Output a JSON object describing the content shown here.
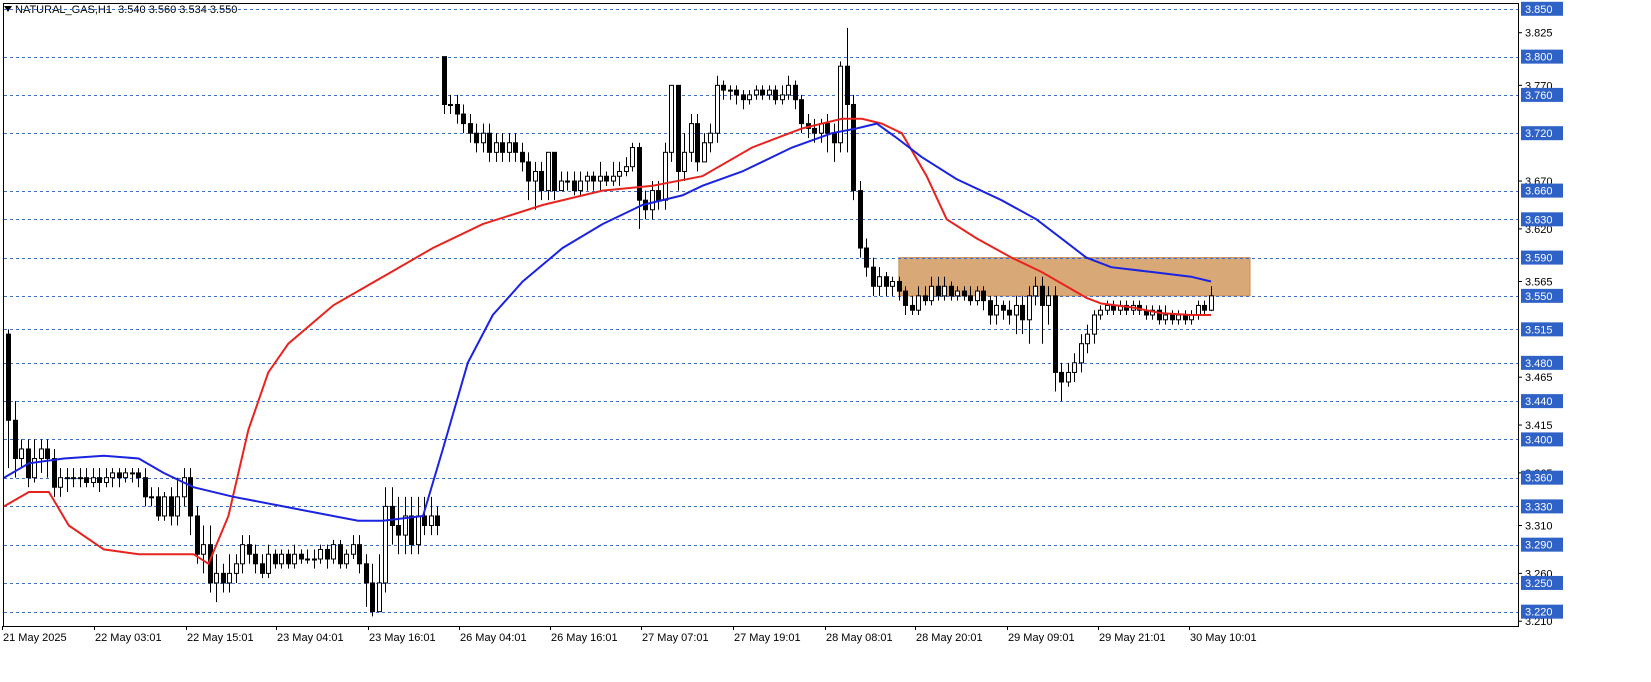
{
  "header": {
    "symbol": "NATURAL_GAS,H1",
    "ohlc": "3.540 3.560 3.534 3.550"
  },
  "colors": {
    "grid": "#3a6fc4",
    "label_bg": "#2f62c6",
    "ma_fast": "#e8231e",
    "ma_slow": "#1a23e0",
    "zone": "#d9a877",
    "candle": "#000000"
  },
  "chart_data": {
    "type": "candlestick",
    "ylim": [
      3.205,
      3.855
    ],
    "y_ticks": [
      3.825,
      3.77,
      3.67,
      3.62,
      3.565,
      3.465,
      3.415,
      3.365,
      3.31,
      3.26,
      3.21
    ],
    "y_levels": [
      3.85,
      3.8,
      3.76,
      3.72,
      3.66,
      3.63,
      3.59,
      3.55,
      3.515,
      3.48,
      3.44,
      3.4,
      3.36,
      3.33,
      3.29,
      3.25,
      3.22
    ],
    "x_labels": [
      "21 May 2025",
      "22 May 03:01",
      "22 May 15:01",
      "23 May 04:01",
      "23 May 16:01",
      "26 May 04:01",
      "26 May 16:01",
      "27 May 07:01",
      "27 May 19:01",
      "28 May 08:01",
      "28 May 20:01",
      "29 May 09:01",
      "29 May 21:01",
      "30 May 10:01"
    ],
    "zone": {
      "bar_start": 137,
      "bar_end": 191,
      "low": 3.55,
      "high": 3.59
    },
    "candles": [
      [
        3.51,
        3.42,
        3.37,
        3.515
      ],
      [
        3.42,
        3.38,
        3.36,
        3.44
      ],
      [
        3.38,
        3.39,
        3.37,
        3.4
      ],
      [
        3.39,
        3.36,
        3.35,
        3.4
      ],
      [
        3.36,
        3.38,
        3.355,
        3.4
      ],
      [
        3.38,
        3.39,
        3.365,
        3.4
      ],
      [
        3.39,
        3.38,
        3.36,
        3.4
      ],
      [
        3.38,
        3.35,
        3.34,
        3.39
      ],
      [
        3.35,
        3.36,
        3.34,
        3.37
      ],
      [
        3.36,
        3.36,
        3.345,
        3.37
      ],
      [
        3.36,
        3.36,
        3.35,
        3.37
      ],
      [
        3.36,
        3.36,
        3.35,
        3.37
      ],
      [
        3.36,
        3.355,
        3.35,
        3.37
      ],
      [
        3.355,
        3.36,
        3.35,
        3.37
      ],
      [
        3.36,
        3.355,
        3.345,
        3.37
      ],
      [
        3.355,
        3.36,
        3.35,
        3.37
      ],
      [
        3.36,
        3.365,
        3.35,
        3.37
      ],
      [
        3.365,
        3.36,
        3.35,
        3.37
      ],
      [
        3.36,
        3.365,
        3.355,
        3.37
      ],
      [
        3.365,
        3.365,
        3.355,
        3.37
      ],
      [
        3.365,
        3.36,
        3.35,
        3.37
      ],
      [
        3.36,
        3.34,
        3.33,
        3.37
      ],
      [
        3.34,
        3.34,
        3.33,
        3.35
      ],
      [
        3.34,
        3.32,
        3.315,
        3.35
      ],
      [
        3.32,
        3.34,
        3.315,
        3.345
      ],
      [
        3.34,
        3.32,
        3.31,
        3.35
      ],
      [
        3.32,
        3.34,
        3.31,
        3.36
      ],
      [
        3.34,
        3.36,
        3.33,
        3.37
      ],
      [
        3.36,
        3.32,
        3.3,
        3.37
      ],
      [
        3.32,
        3.28,
        3.27,
        3.33
      ],
      [
        3.28,
        3.29,
        3.26,
        3.31
      ],
      [
        3.29,
        3.25,
        3.24,
        3.31
      ],
      [
        3.25,
        3.26,
        3.23,
        3.28
      ],
      [
        3.26,
        3.25,
        3.24,
        3.27
      ],
      [
        3.25,
        3.26,
        3.24,
        3.28
      ],
      [
        3.26,
        3.27,
        3.25,
        3.28
      ],
      [
        3.27,
        3.29,
        3.26,
        3.3
      ],
      [
        3.29,
        3.28,
        3.27,
        3.3
      ],
      [
        3.28,
        3.27,
        3.26,
        3.29
      ],
      [
        3.27,
        3.26,
        3.255,
        3.28
      ],
      [
        3.26,
        3.28,
        3.255,
        3.29
      ],
      [
        3.28,
        3.27,
        3.265,
        3.285
      ],
      [
        3.27,
        3.28,
        3.265,
        3.285
      ],
      [
        3.28,
        3.27,
        3.265,
        3.285
      ],
      [
        3.27,
        3.28,
        3.265,
        3.29
      ],
      [
        3.28,
        3.275,
        3.27,
        3.285
      ],
      [
        3.275,
        3.275,
        3.27,
        3.285
      ],
      [
        3.275,
        3.275,
        3.265,
        3.285
      ],
      [
        3.275,
        3.285,
        3.27,
        3.29
      ],
      [
        3.285,
        3.275,
        3.265,
        3.29
      ],
      [
        3.275,
        3.29,
        3.27,
        3.295
      ],
      [
        3.29,
        3.27,
        3.265,
        3.295
      ],
      [
        3.27,
        3.28,
        3.265,
        3.285
      ],
      [
        3.28,
        3.29,
        3.275,
        3.3
      ],
      [
        3.29,
        3.27,
        3.26,
        3.3
      ],
      [
        3.27,
        3.25,
        3.225,
        3.28
      ],
      [
        3.25,
        3.22,
        3.215,
        3.27
      ],
      [
        3.22,
        3.25,
        3.22,
        3.28
      ],
      [
        3.25,
        3.33,
        3.24,
        3.35
      ],
      [
        3.33,
        3.31,
        3.29,
        3.35
      ],
      [
        3.31,
        3.3,
        3.28,
        3.34
      ],
      [
        3.3,
        3.32,
        3.28,
        3.34
      ],
      [
        3.32,
        3.29,
        3.28,
        3.34
      ],
      [
        3.29,
        3.32,
        3.28,
        3.34
      ],
      [
        3.32,
        3.31,
        3.3,
        3.34
      ],
      [
        3.31,
        3.32,
        3.3,
        3.34
      ],
      [
        3.32,
        3.31,
        3.3,
        3.33
      ],
      [
        3.8,
        3.75,
        3.74,
        3.8
      ],
      [
        3.75,
        3.75,
        3.74,
        3.76
      ],
      [
        3.75,
        3.74,
        3.73,
        3.76
      ],
      [
        3.74,
        3.73,
        3.72,
        3.75
      ],
      [
        3.73,
        3.72,
        3.71,
        3.74
      ],
      [
        3.72,
        3.71,
        3.7,
        3.73
      ],
      [
        3.71,
        3.72,
        3.7,
        3.73
      ],
      [
        3.72,
        3.7,
        3.69,
        3.73
      ],
      [
        3.7,
        3.71,
        3.69,
        3.72
      ],
      [
        3.71,
        3.7,
        3.69,
        3.72
      ],
      [
        3.7,
        3.71,
        3.69,
        3.72
      ],
      [
        3.71,
        3.7,
        3.69,
        3.72
      ],
      [
        3.7,
        3.69,
        3.68,
        3.71
      ],
      [
        3.69,
        3.67,
        3.65,
        3.7
      ],
      [
        3.67,
        3.68,
        3.64,
        3.69
      ],
      [
        3.68,
        3.66,
        3.65,
        3.69
      ],
      [
        3.66,
        3.7,
        3.65,
        3.7
      ],
      [
        3.7,
        3.66,
        3.65,
        3.7
      ],
      [
        3.66,
        3.67,
        3.66,
        3.68
      ],
      [
        3.67,
        3.67,
        3.66,
        3.68
      ],
      [
        3.67,
        3.66,
        3.655,
        3.68
      ],
      [
        3.66,
        3.67,
        3.655,
        3.68
      ],
      [
        3.67,
        3.675,
        3.66,
        3.68
      ],
      [
        3.675,
        3.67,
        3.66,
        3.68
      ],
      [
        3.67,
        3.675,
        3.66,
        3.69
      ],
      [
        3.675,
        3.67,
        3.665,
        3.68
      ],
      [
        3.67,
        3.675,
        3.665,
        3.69
      ],
      [
        3.675,
        3.68,
        3.665,
        3.69
      ],
      [
        3.68,
        3.685,
        3.675,
        3.695
      ],
      [
        3.685,
        3.705,
        3.68,
        3.71
      ],
      [
        3.705,
        3.65,
        3.62,
        3.71
      ],
      [
        3.65,
        3.64,
        3.63,
        3.66
      ],
      [
        3.64,
        3.66,
        3.63,
        3.67
      ],
      [
        3.66,
        3.65,
        3.64,
        3.67
      ],
      [
        3.65,
        3.7,
        3.64,
        3.71
      ],
      [
        3.7,
        3.77,
        3.69,
        3.77
      ],
      [
        3.77,
        3.68,
        3.66,
        3.77
      ],
      [
        3.68,
        3.7,
        3.67,
        3.72
      ],
      [
        3.7,
        3.73,
        3.69,
        3.74
      ],
      [
        3.73,
        3.69,
        3.68,
        3.74
      ],
      [
        3.69,
        3.71,
        3.69,
        3.72
      ],
      [
        3.71,
        3.72,
        3.7,
        3.73
      ],
      [
        3.72,
        3.77,
        3.71,
        3.78
      ],
      [
        3.77,
        3.765,
        3.755,
        3.775
      ],
      [
        3.765,
        3.765,
        3.755,
        3.77
      ],
      [
        3.765,
        3.76,
        3.75,
        3.77
      ],
      [
        3.76,
        3.755,
        3.745,
        3.765
      ],
      [
        3.755,
        3.76,
        3.75,
        3.765
      ],
      [
        3.76,
        3.765,
        3.755,
        3.77
      ],
      [
        3.765,
        3.76,
        3.755,
        3.77
      ],
      [
        3.76,
        3.765,
        3.755,
        3.77
      ],
      [
        3.765,
        3.755,
        3.75,
        3.77
      ],
      [
        3.755,
        3.76,
        3.75,
        3.77
      ],
      [
        3.76,
        3.77,
        3.755,
        3.78
      ],
      [
        3.77,
        3.755,
        3.745,
        3.775
      ],
      [
        3.755,
        3.73,
        3.72,
        3.76
      ],
      [
        3.73,
        3.725,
        3.715,
        3.74
      ],
      [
        3.725,
        3.72,
        3.71,
        3.735
      ],
      [
        3.72,
        3.73,
        3.71,
        3.735
      ],
      [
        3.73,
        3.72,
        3.7,
        3.74
      ],
      [
        3.72,
        3.71,
        3.69,
        3.73
      ],
      [
        3.71,
        3.79,
        3.7,
        3.795
      ],
      [
        3.79,
        3.75,
        3.7,
        3.83
      ],
      [
        3.75,
        3.66,
        3.65,
        3.76
      ],
      [
        3.66,
        3.6,
        3.59,
        3.67
      ],
      [
        3.6,
        3.58,
        3.57,
        3.61
      ],
      [
        3.58,
        3.56,
        3.55,
        3.59
      ],
      [
        3.56,
        3.57,
        3.55,
        3.58
      ],
      [
        3.57,
        3.56,
        3.55,
        3.575
      ],
      [
        3.56,
        3.565,
        3.55,
        3.57
      ],
      [
        3.565,
        3.555,
        3.545,
        3.57
      ],
      [
        3.555,
        3.54,
        3.53,
        3.56
      ],
      [
        3.54,
        3.535,
        3.53,
        3.55
      ],
      [
        3.535,
        3.55,
        3.53,
        3.56
      ],
      [
        3.55,
        3.545,
        3.54,
        3.56
      ],
      [
        3.545,
        3.56,
        3.54,
        3.57
      ],
      [
        3.56,
        3.55,
        3.545,
        3.57
      ],
      [
        3.55,
        3.56,
        3.545,
        3.57
      ],
      [
        3.56,
        3.55,
        3.545,
        3.565
      ],
      [
        3.55,
        3.555,
        3.545,
        3.56
      ],
      [
        3.555,
        3.55,
        3.545,
        3.56
      ],
      [
        3.55,
        3.545,
        3.54,
        3.56
      ],
      [
        3.545,
        3.555,
        3.54,
        3.56
      ],
      [
        3.555,
        3.545,
        3.535,
        3.56
      ],
      [
        3.545,
        3.53,
        3.52,
        3.55
      ],
      [
        3.53,
        3.54,
        3.52,
        3.55
      ],
      [
        3.54,
        3.535,
        3.525,
        3.545
      ],
      [
        3.535,
        3.53,
        3.52,
        3.545
      ],
      [
        3.53,
        3.54,
        3.51,
        3.55
      ],
      [
        3.54,
        3.525,
        3.51,
        3.55
      ],
      [
        3.525,
        3.55,
        3.5,
        3.56
      ],
      [
        3.55,
        3.56,
        3.54,
        3.57
      ],
      [
        3.56,
        3.54,
        3.5,
        3.57
      ],
      [
        3.54,
        3.55,
        3.52,
        3.56
      ],
      [
        3.55,
        3.47,
        3.45,
        3.56
      ],
      [
        3.47,
        3.46,
        3.44,
        3.48
      ],
      [
        3.46,
        3.47,
        3.455,
        3.48
      ],
      [
        3.47,
        3.48,
        3.46,
        3.49
      ],
      [
        3.48,
        3.5,
        3.47,
        3.51
      ],
      [
        3.5,
        3.51,
        3.49,
        3.52
      ],
      [
        3.51,
        3.53,
        3.5,
        3.535
      ],
      [
        3.53,
        3.535,
        3.525,
        3.54
      ],
      [
        3.535,
        3.54,
        3.53,
        3.545
      ],
      [
        3.54,
        3.535,
        3.53,
        3.545
      ],
      [
        3.535,
        3.54,
        3.53,
        3.545
      ],
      [
        3.54,
        3.535,
        3.53,
        3.545
      ],
      [
        3.535,
        3.54,
        3.53,
        3.545
      ],
      [
        3.54,
        3.535,
        3.53,
        3.545
      ],
      [
        3.535,
        3.53,
        3.525,
        3.54
      ],
      [
        3.53,
        3.535,
        3.525,
        3.54
      ],
      [
        3.535,
        3.525,
        3.52,
        3.54
      ],
      [
        3.525,
        3.53,
        3.52,
        3.54
      ],
      [
        3.53,
        3.525,
        3.52,
        3.535
      ],
      [
        3.525,
        3.53,
        3.52,
        3.535
      ],
      [
        3.53,
        3.525,
        3.52,
        3.535
      ],
      [
        3.525,
        3.53,
        3.52,
        3.535
      ],
      [
        3.53,
        3.54,
        3.525,
        3.545
      ],
      [
        3.54,
        3.535,
        3.53,
        3.545
      ],
      [
        3.535,
        3.55,
        3.534,
        3.56
      ]
    ],
    "ma_fast": [
      [
        0,
        3.33
      ],
      [
        25,
        3.345
      ],
      [
        45,
        3.345
      ],
      [
        65,
        3.31
      ],
      [
        100,
        3.285
      ],
      [
        135,
        3.28
      ],
      [
        160,
        3.28
      ],
      [
        190,
        3.28
      ],
      [
        205,
        3.27
      ],
      [
        225,
        3.32
      ],
      [
        245,
        3.41
      ],
      [
        265,
        3.47
      ],
      [
        285,
        3.5
      ],
      [
        330,
        3.54
      ],
      [
        380,
        3.57
      ],
      [
        430,
        3.6
      ],
      [
        480,
        3.625
      ],
      [
        540,
        3.645
      ],
      [
        600,
        3.66
      ],
      [
        650,
        3.665
      ],
      [
        700,
        3.675
      ],
      [
        750,
        3.705
      ],
      [
        800,
        3.725
      ],
      [
        840,
        3.735
      ],
      [
        860,
        3.735
      ],
      [
        880,
        3.73
      ],
      [
        900,
        3.72
      ],
      [
        925,
        3.675
      ],
      [
        945,
        3.63
      ],
      [
        975,
        3.61
      ],
      [
        1010,
        3.59
      ],
      [
        1040,
        3.575
      ],
      [
        1065,
        3.56
      ],
      [
        1085,
        3.548
      ],
      [
        1100,
        3.542
      ],
      [
        1130,
        3.538
      ],
      [
        1160,
        3.532
      ],
      [
        1190,
        3.53
      ],
      [
        1210,
        3.53
      ]
    ],
    "ma_slow": [
      [
        0,
        3.36
      ],
      [
        25,
        3.375
      ],
      [
        60,
        3.38
      ],
      [
        100,
        3.383
      ],
      [
        135,
        3.38
      ],
      [
        160,
        3.365
      ],
      [
        190,
        3.35
      ],
      [
        230,
        3.34
      ],
      [
        280,
        3.33
      ],
      [
        330,
        3.32
      ],
      [
        355,
        3.315
      ],
      [
        380,
        3.315
      ],
      [
        420,
        3.32
      ],
      [
        440,
        3.39
      ],
      [
        465,
        3.48
      ],
      [
        490,
        3.53
      ],
      [
        520,
        3.565
      ],
      [
        560,
        3.6
      ],
      [
        600,
        3.625
      ],
      [
        640,
        3.645
      ],
      [
        680,
        3.655
      ],
      [
        700,
        3.665
      ],
      [
        740,
        3.68
      ],
      [
        790,
        3.705
      ],
      [
        830,
        3.72
      ],
      [
        855,
        3.725
      ],
      [
        875,
        3.73
      ],
      [
        895,
        3.715
      ],
      [
        920,
        3.695
      ],
      [
        955,
        3.672
      ],
      [
        1000,
        3.65
      ],
      [
        1035,
        3.63
      ],
      [
        1060,
        3.61
      ],
      [
        1085,
        3.59
      ],
      [
        1110,
        3.58
      ],
      [
        1150,
        3.575
      ],
      [
        1190,
        3.57
      ],
      [
        1210,
        3.565
      ]
    ]
  }
}
